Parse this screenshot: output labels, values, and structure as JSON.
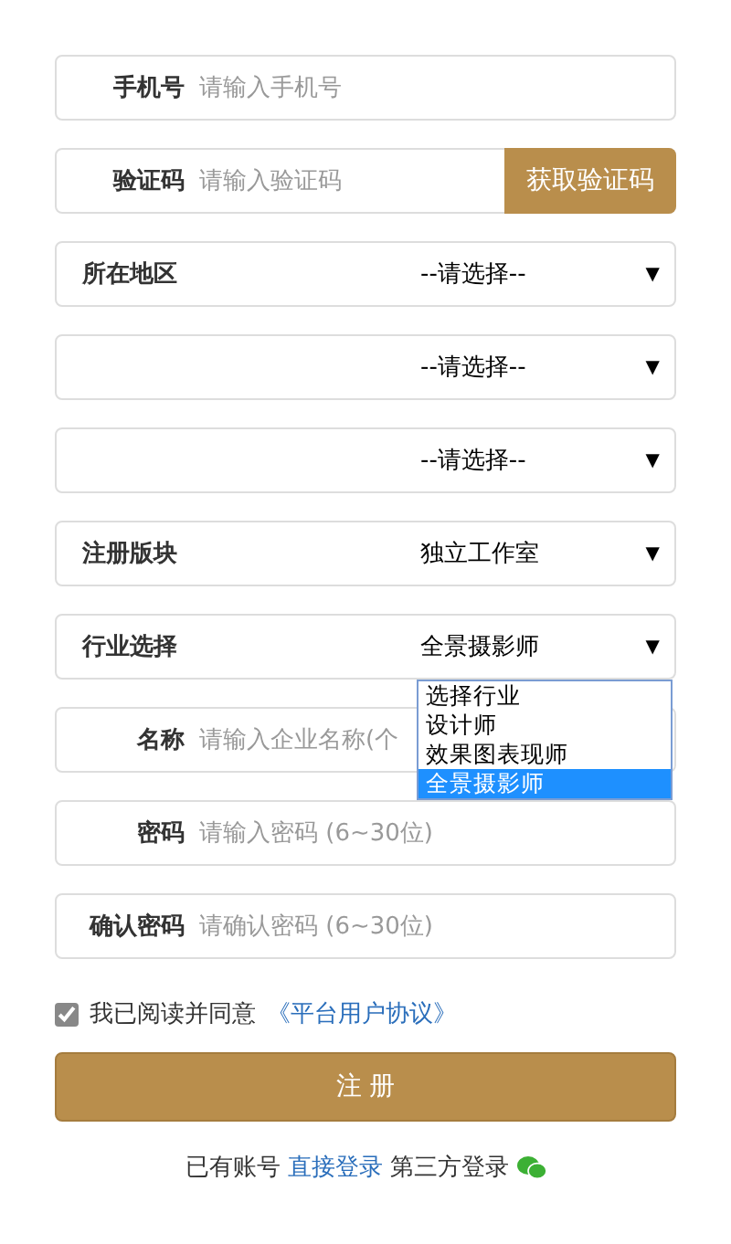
{
  "fields": [
    {
      "kind": "input",
      "label": "手机号",
      "placeholder": "请输入手机号"
    },
    {
      "kind": "input_button",
      "label": "验证码",
      "placeholder": "请输入验证码",
      "button": "获取验证码"
    },
    {
      "kind": "select",
      "label": "所在地区",
      "value": "--请选择--",
      "arrow": "▼"
    },
    {
      "kind": "select",
      "value": "--请选择--",
      "arrow": "▼"
    },
    {
      "kind": "select",
      "value": "--请选择--",
      "arrow": "▼"
    },
    {
      "kind": "select",
      "label": "注册版块",
      "value": "独立工作室",
      "arrow": "▼"
    },
    {
      "kind": "select",
      "label": "行业选择",
      "value": "全景摄影师",
      "arrow": "▼",
      "expanded": true,
      "options": [
        {
          "label": "选择行业",
          "selected": false
        },
        {
          "label": "设计师",
          "selected": false
        },
        {
          "label": "效果图表现师",
          "selected": false
        },
        {
          "label": "全景摄影师",
          "selected": true
        }
      ]
    },
    {
      "kind": "input",
      "label": "名称",
      "placeholder": "请输入企业名称(个"
    },
    {
      "kind": "input",
      "label": "密码",
      "placeholder": "请输入密码 (6~30位)"
    },
    {
      "kind": "input",
      "label": "确认密码",
      "placeholder": "请确认密码 (6~30位)"
    }
  ],
  "agreement": {
    "checked": true,
    "text": "我已阅读并同意",
    "link": "《平台用户协议》"
  },
  "submit": "注 册",
  "footer": {
    "text": "已有账号",
    "link": "直接登录",
    "third_party": "第三方登录"
  }
}
